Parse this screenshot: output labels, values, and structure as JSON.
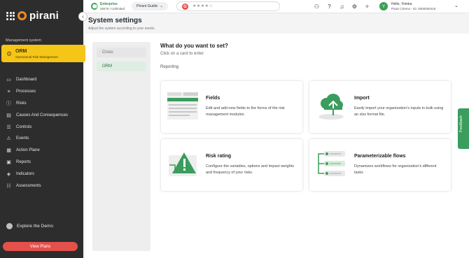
{
  "brand": {
    "name": "pirani"
  },
  "sidebar": {
    "section_label": "Management system",
    "module": {
      "title": "ORM",
      "subtitle": "Operational Risk Management"
    },
    "items": [
      {
        "label": "Dashboard",
        "icon": "monitor-icon"
      },
      {
        "label": "Processes",
        "icon": "processes-icon"
      },
      {
        "label": "Risks",
        "icon": "risk-icon"
      },
      {
        "label": "Causes And Consequences",
        "icon": "causes-icon"
      },
      {
        "label": "Controls",
        "icon": "controls-icon"
      },
      {
        "label": "Events",
        "icon": "events-icon"
      },
      {
        "label": "Action Plane",
        "icon": "action-plan-icon"
      },
      {
        "label": "Reports",
        "icon": "reports-icon"
      },
      {
        "label": "Indicators",
        "icon": "indicators-icon"
      },
      {
        "label": "Assessments",
        "icon": "assessments-icon"
      }
    ],
    "explore": "Explore the Demo",
    "view_plans": "View Plans"
  },
  "topbar": {
    "plan_name": "Enterprise",
    "plan_usage": "28476 / Unlimited",
    "guide": "Pirani Guide",
    "rating_logo": "G",
    "rating_stars": "★★★★☆",
    "user_initial": "Y",
    "user_greeting": "Hello, Yomira",
    "user_org": "Pirani | Demo - ID: 0000000419"
  },
  "page": {
    "title": "System settings",
    "subtitle": "Adjust the system according to your needs."
  },
  "tabs": [
    "Cross",
    "ORM"
  ],
  "main": {
    "question": "What do you want to set?",
    "hint": "Click on a card to enter.",
    "section": "Reporting",
    "cards": [
      {
        "title": "Fields",
        "desc": "Edit and add new fields to the forms of the risk management modules."
      },
      {
        "title": "Import",
        "desc": "Easily import your organization's inputs in bulk using an xlsx format file."
      },
      {
        "title": "Risk rating",
        "desc": "Configure the variables, options and impact weights and frequency of your risks."
      },
      {
        "title": "Parameterizable flows",
        "desc": "Dynamizes workflows for organization's different tasks"
      }
    ]
  },
  "feedback": "Feedback",
  "colors": {
    "accent": "#f5c518",
    "green": "#3a9d5d",
    "sidebar": "#2d2d2d",
    "danger": "#e4514b"
  }
}
